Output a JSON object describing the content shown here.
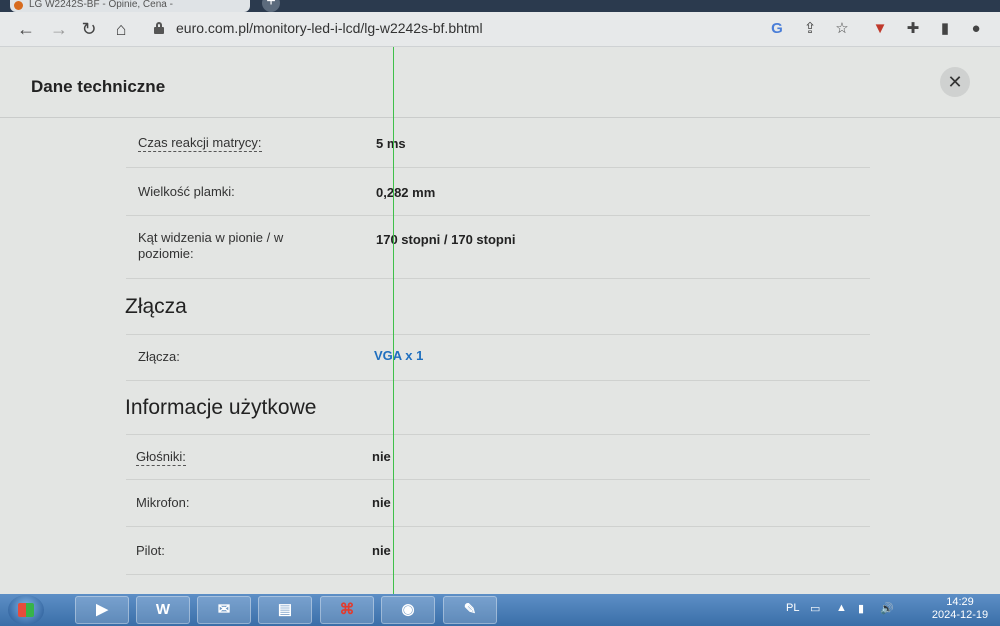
{
  "browser": {
    "tab_title": "LG W2242S-BF - Opinie, Cena -",
    "new_tab_label": "+",
    "url": "euro.com.pl/monitory-led-i-lcd/lg-w2242s-bf.bhtml",
    "google_label": "G"
  },
  "page": {
    "dialog_title": "Dane techniczne",
    "close_label": "✕",
    "rows_top": [
      {
        "label": "Czas reakcji matrycy:",
        "value": "5 ms"
      },
      {
        "label": "Wielkość plamki:",
        "value": "0,282 mm"
      },
      {
        "label": "Kąt widzenia w pionie / w poziomie:",
        "value": "170 stopni / 170 stopni"
      }
    ],
    "section_connectors": {
      "title": "Złącza",
      "rows": [
        {
          "label": "Złącza:",
          "value": "VGA x 1"
        }
      ]
    },
    "section_usage": {
      "title": "Informacje użytkowe",
      "rows": [
        {
          "label": "Głośniki:",
          "value": "nie"
        },
        {
          "label": "Mikrofon:",
          "value": "nie"
        },
        {
          "label": "Pilot:",
          "value": "nie"
        }
      ]
    }
  },
  "taskbar": {
    "apps": [
      "media-player",
      "word",
      "outlook",
      "file-explorer",
      "acrobat",
      "chrome",
      "paint"
    ],
    "word_label": "W",
    "language": "PL",
    "time": "14:29",
    "date": "2024-12-19"
  },
  "colors": {
    "link": "#1f6fbf",
    "taskbar": "#3a6ea8"
  }
}
